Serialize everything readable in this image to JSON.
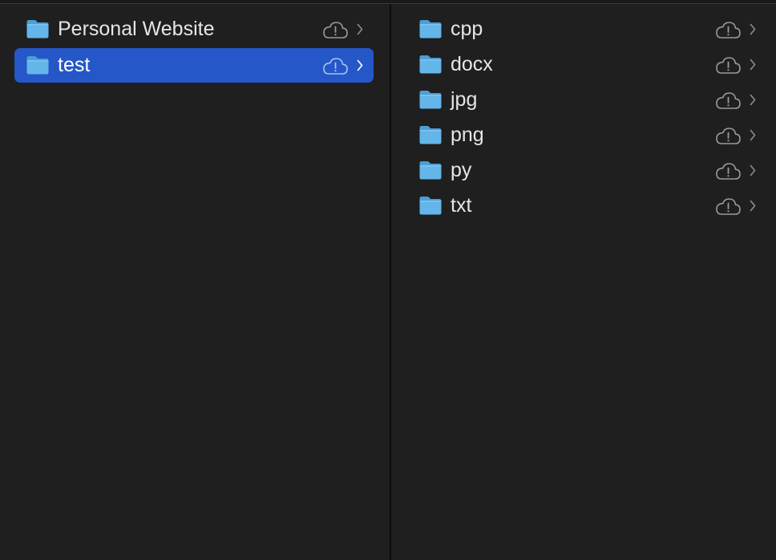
{
  "colors": {
    "background": "#1f1f1f",
    "selection": "#2557c9",
    "text": "#e6e6e6",
    "folder": "#5fb4e8",
    "icon_gray": "#9a9a9a"
  },
  "left_column": {
    "items": [
      {
        "label": "Personal Website",
        "icon": "folder-icon",
        "status_icon": "cloud-alert-icon",
        "selected": false
      },
      {
        "label": "test",
        "icon": "folder-icon",
        "status_icon": "cloud-alert-icon",
        "selected": true
      }
    ]
  },
  "right_column": {
    "items": [
      {
        "label": "cpp",
        "icon": "folder-icon",
        "status_icon": "cloud-alert-icon"
      },
      {
        "label": "docx",
        "icon": "folder-icon",
        "status_icon": "cloud-alert-icon"
      },
      {
        "label": "jpg",
        "icon": "folder-icon",
        "status_icon": "cloud-alert-icon"
      },
      {
        "label": "png",
        "icon": "folder-icon",
        "status_icon": "cloud-alert-icon"
      },
      {
        "label": "py",
        "icon": "folder-icon",
        "status_icon": "cloud-alert-icon"
      },
      {
        "label": "txt",
        "icon": "folder-icon",
        "status_icon": "cloud-alert-icon"
      }
    ]
  }
}
